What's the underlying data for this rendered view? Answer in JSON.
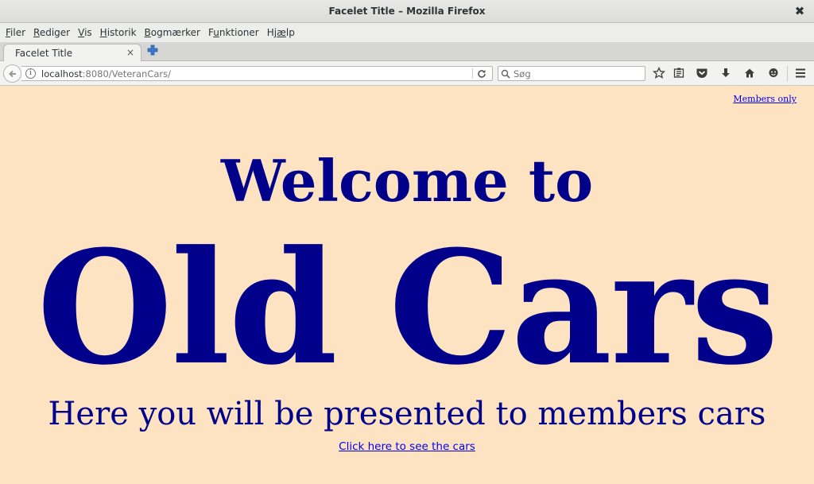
{
  "window": {
    "title": "Facelet Title – Mozilla Firefox",
    "close_symbol": "✖"
  },
  "menubar": {
    "items": [
      {
        "mnemonic": "F",
        "rest": "iler"
      },
      {
        "mnemonic": "R",
        "rest": "ediger"
      },
      {
        "mnemonic": "V",
        "rest": "is"
      },
      {
        "mnemonic": "H",
        "rest": "istorik"
      },
      {
        "mnemonic": "B",
        "rest": "ogmærker"
      },
      {
        "pre": "F",
        "mnemonic": "u",
        "rest": "nktioner"
      },
      {
        "pre": "Hj",
        "mnemonic": "æ",
        "rest": "lp"
      }
    ]
  },
  "tabs": [
    {
      "label": "Facelet Title",
      "close": "×"
    }
  ],
  "navbar": {
    "back_icon": "arrow-left-icon",
    "url_host": "localhost",
    "url_rest": ":8080/VeteranCars/",
    "search_placeholder": "Søg",
    "icons": [
      "star-icon",
      "reading-list-icon",
      "pocket-icon",
      "download-icon",
      "home-icon",
      "chat-icon",
      "hamburger-menu-icon"
    ]
  },
  "page": {
    "background": "#fee3c2",
    "text_color": "#00008b",
    "members_link": "Members only",
    "heading_welcome": "Welcome to",
    "heading_main": "Old Cars",
    "subtitle": "Here you will be presented to members cars",
    "cars_link": "Click here to see the cars"
  }
}
